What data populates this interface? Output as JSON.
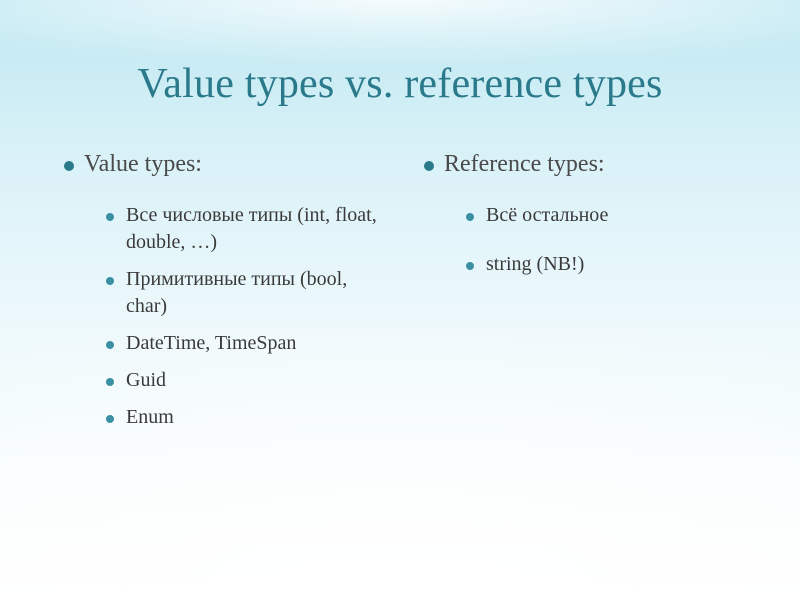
{
  "title": "Value types vs. reference types",
  "left": {
    "heading": "Value types:",
    "items": [
      "Все числовые типы (int, float, double, …)",
      "Примитивные типы (bool, char)",
      "DateTime, TimeSpan",
      "Guid",
      "Enum"
    ]
  },
  "right": {
    "heading": "Reference types:",
    "items": [
      "Всё остальное",
      "string (NB!)"
    ]
  }
}
